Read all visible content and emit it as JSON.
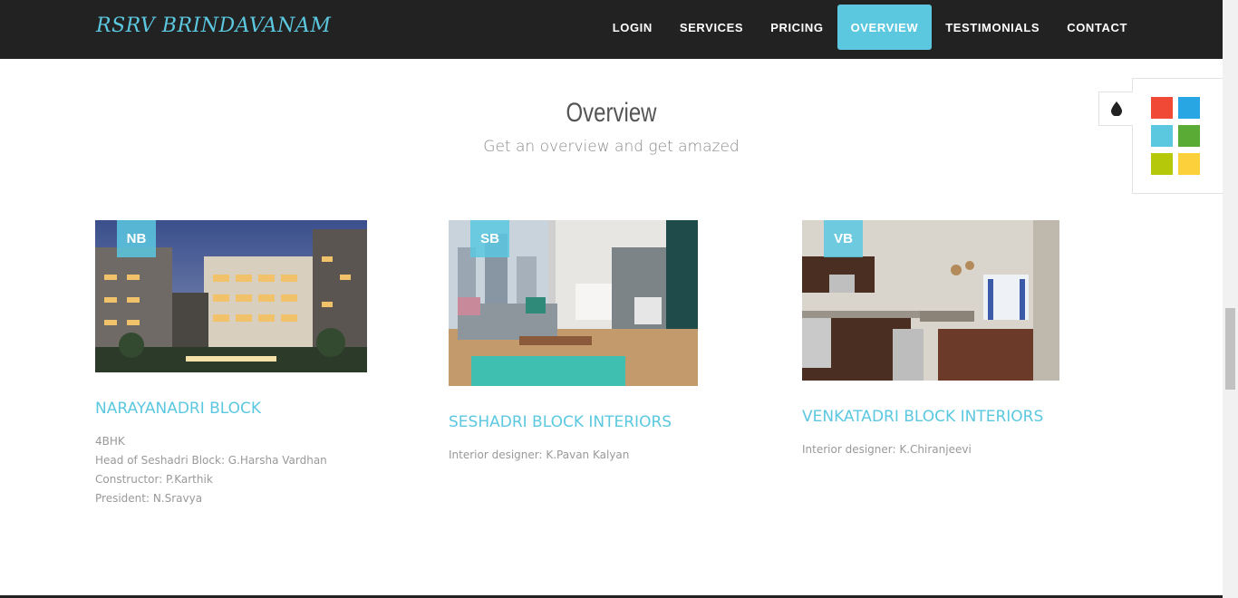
{
  "brand": "RSRV BRINDAVANAM",
  "nav": {
    "items": [
      {
        "label": "LOGIN",
        "active": false
      },
      {
        "label": "SERVICES",
        "active": false
      },
      {
        "label": "PRICING",
        "active": false
      },
      {
        "label": "OVERVIEW",
        "active": true
      },
      {
        "label": "TESTIMONIALS",
        "active": false
      },
      {
        "label": "CONTACT",
        "active": false
      }
    ]
  },
  "section": {
    "title": "Overview",
    "subtitle": "Get an overview and get amazed"
  },
  "cards": [
    {
      "badge": "NB",
      "title": "NARAYANADRI BLOCK",
      "lines": [
        "4BHK",
        "Head of Seshadri Block: G.Harsha Vardhan",
        "Constructor: P.Karthik",
        "President: N.Sravya"
      ]
    },
    {
      "badge": "SB",
      "title": "SESHADRI BLOCK INTERIORS",
      "lines": [
        "Interior designer: K.Pavan Kalyan"
      ]
    },
    {
      "badge": "VB",
      "title": "VENKATADRI BLOCK INTERIORS",
      "lines": [
        "Interior designer: K.Chiranjeevi"
      ]
    }
  ],
  "style_switcher": {
    "icon": "droplet-icon",
    "swatches": [
      "#f04a37",
      "#27a6e3",
      "#5bc8e0",
      "#5aab35",
      "#b5c90a",
      "#fcd03a"
    ]
  },
  "colors": {
    "accent": "#5bc8e0",
    "navbar": "#222222"
  }
}
